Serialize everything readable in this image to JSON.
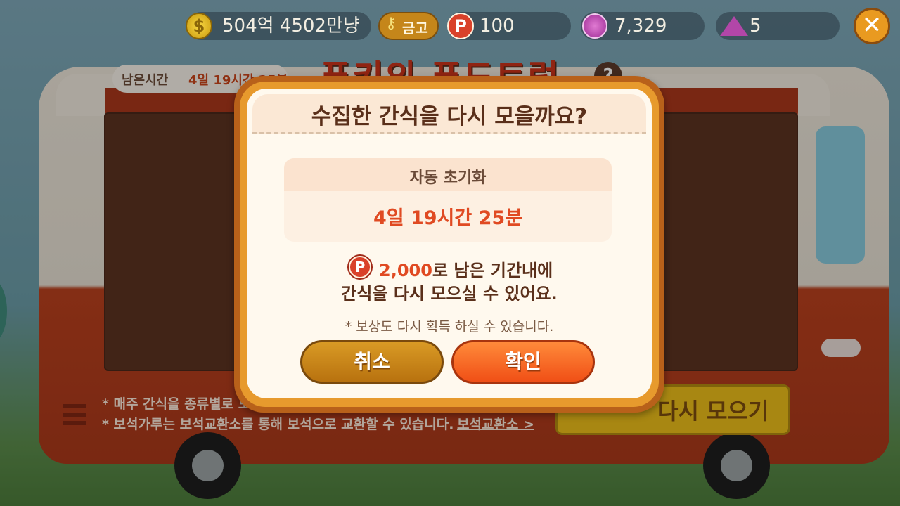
{
  "hud": {
    "coin_symbol": "$",
    "coins": "504억 4502만냥",
    "vault_label": "금고",
    "p_symbol": "P",
    "points": "100",
    "gems": "7,329",
    "gem_dust": "5",
    "close_symbol": "✕"
  },
  "background": {
    "remaining_label": "남은시간",
    "remaining_value": "4일 19시간 25분",
    "event_title": "푸키의 푸드트럭",
    "help_symbol": "?",
    "footnote_1": "* 매주 간식을 종류별로 모",
    "footnote_2": "* 보석가루는 보석교환소를 통해 보석으로 교환할 수 있습니다.",
    "exchange_link": "보석교환소 >",
    "recollect_button": "다시 모으기"
  },
  "dialog": {
    "title": "수집한 간식을 다시 모을까요?",
    "reset_label": "자동 초기화",
    "reset_time": "4일 19시간 25분",
    "p_symbol": "P",
    "cost": "2,000",
    "message_line1_suffix": "로 남은 기간내에",
    "message_line2": "간식을 다시 모으실 수 있어요.",
    "note": "* 보상도 다시 획득 하실 수 있습니다.",
    "cancel_label": "취소",
    "confirm_label": "확인"
  },
  "colors": {
    "accent_red": "#e04a22",
    "title_brown": "#5a2f1a",
    "dialog_frame": "#e79a2d",
    "cancel_button": "#c98616",
    "confirm_button": "#f56a22"
  }
}
